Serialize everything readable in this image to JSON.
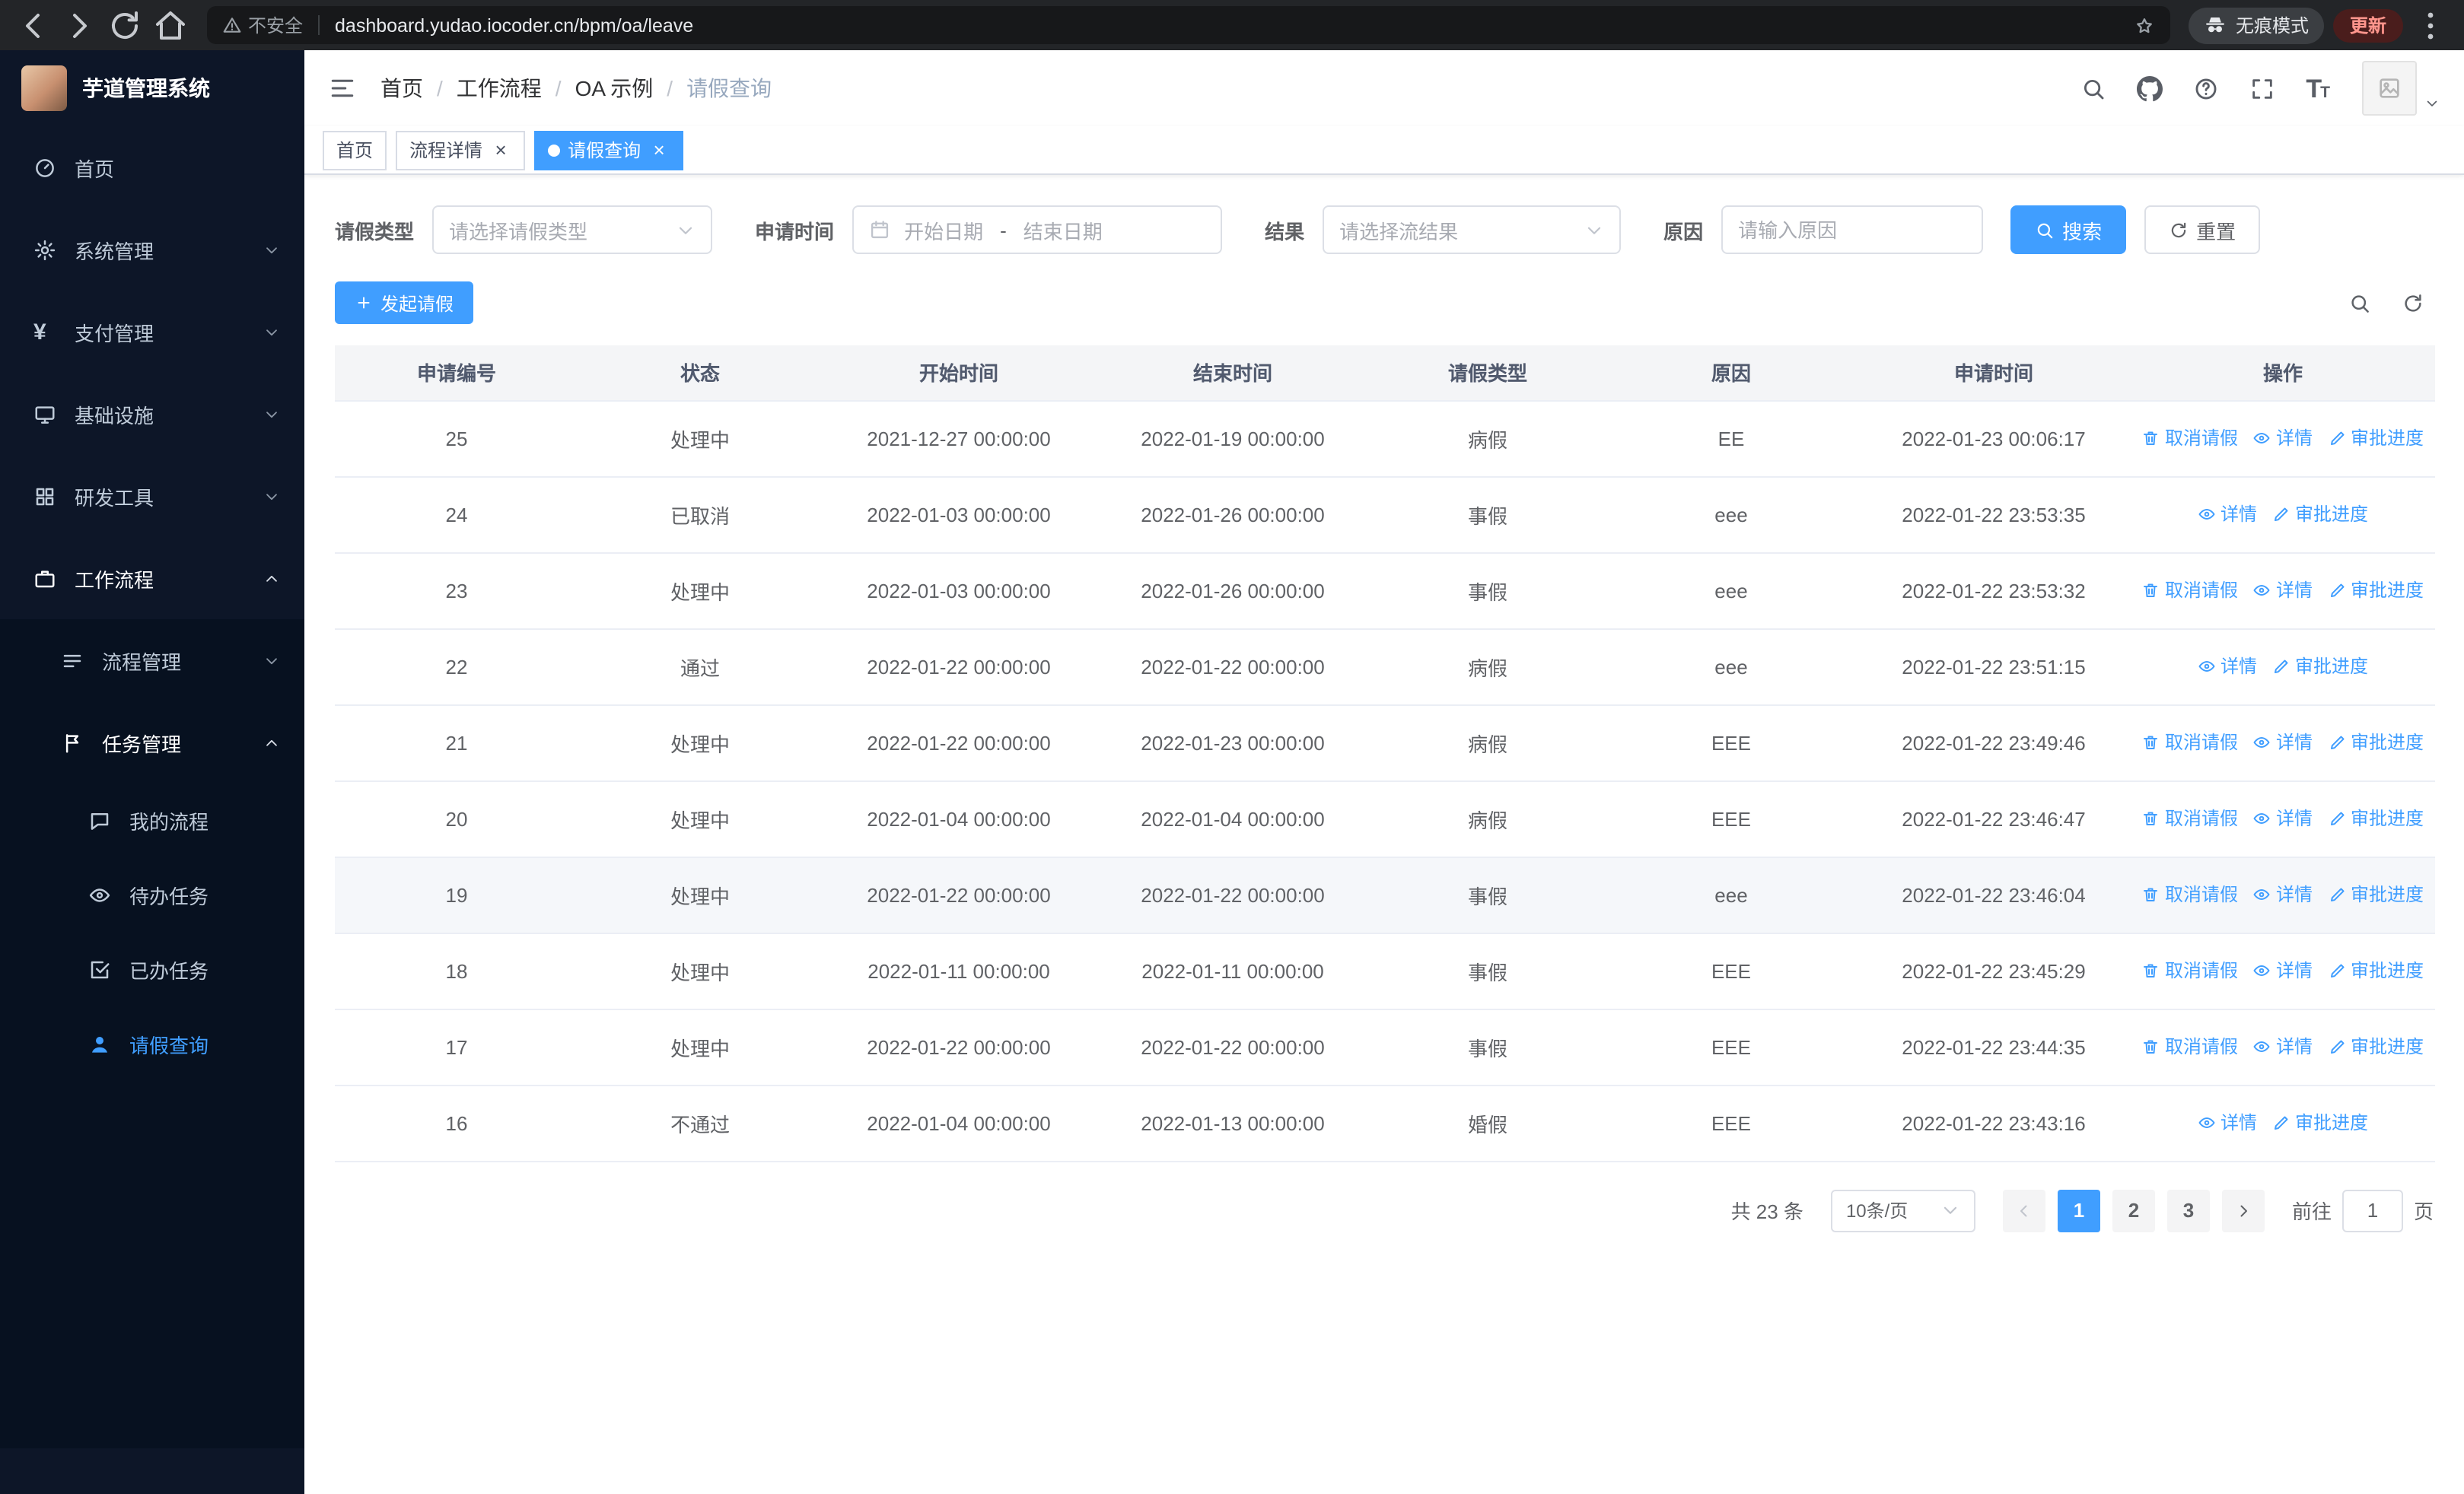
{
  "browser": {
    "url": "dashboard.yudao.iocoder.cn/bpm/oa/leave",
    "security_warning": "不安全",
    "incognito_label": "无痕模式",
    "update_label": "更新"
  },
  "sidebar": {
    "logo_title": "芋道管理系统",
    "menu": [
      {
        "label": "首页",
        "icon": "dashboard-icon",
        "level": 1,
        "sub": false,
        "arrow": null,
        "state": "normal"
      },
      {
        "label": "系统管理",
        "icon": "gear-icon",
        "level": 1,
        "sub": false,
        "arrow": "down",
        "state": "normal"
      },
      {
        "label": "支付管理",
        "icon": "yen-icon",
        "level": 1,
        "sub": false,
        "arrow": "down",
        "state": "normal"
      },
      {
        "label": "基础设施",
        "icon": "infrastructure-icon",
        "level": 1,
        "sub": false,
        "arrow": "down",
        "state": "normal"
      },
      {
        "label": "研发工具",
        "icon": "tools-icon",
        "level": 1,
        "sub": false,
        "arrow": "down",
        "state": "normal"
      },
      {
        "label": "工作流程",
        "icon": "workflow-icon",
        "level": 1,
        "sub": false,
        "arrow": "up",
        "state": "open"
      },
      {
        "label": "流程管理",
        "icon": "process-icon",
        "level": 2,
        "sub": true,
        "arrow": "down",
        "state": "normal"
      },
      {
        "label": "任务管理",
        "icon": "task-icon",
        "level": 2,
        "sub": true,
        "arrow": "up",
        "state": "open"
      },
      {
        "label": "我的流程",
        "icon": "my-process-icon",
        "level": 3,
        "sub": true,
        "arrow": null,
        "state": "normal"
      },
      {
        "label": "待办任务",
        "icon": "eye-icon",
        "level": 3,
        "sub": true,
        "arrow": null,
        "state": "normal"
      },
      {
        "label": "已办任务",
        "icon": "done-task-icon",
        "level": 3,
        "sub": true,
        "arrow": null,
        "state": "normal"
      },
      {
        "label": "请假查询",
        "icon": "user-icon",
        "level": 3,
        "sub": true,
        "arrow": null,
        "state": "active"
      }
    ]
  },
  "header": {
    "breadcrumb": [
      "首页",
      "工作流程",
      "OA 示例",
      "请假查询"
    ]
  },
  "tabs": [
    {
      "label": "首页",
      "closable": false,
      "active": false
    },
    {
      "label": "流程详情",
      "closable": true,
      "active": false
    },
    {
      "label": "请假查询",
      "closable": true,
      "active": true
    }
  ],
  "filters": {
    "type_label": "请假类型",
    "type_placeholder": "请选择请假类型",
    "time_label": "申请时间",
    "date_start_placeholder": "开始日期",
    "date_separator": "-",
    "date_end_placeholder": "结束日期",
    "result_label": "结果",
    "result_placeholder": "请选择流结果",
    "reason_label": "原因",
    "reason_placeholder": "请输入原因",
    "search_label": "搜索",
    "reset_label": "重置"
  },
  "toolbar": {
    "create_label": "发起请假"
  },
  "table": {
    "headers": [
      "申请编号",
      "状态",
      "开始时间",
      "结束时间",
      "请假类型",
      "原因",
      "申请时间",
      "操作"
    ],
    "action_labels": {
      "cancel": "取消请假",
      "detail": "详情",
      "progress": "审批进度"
    },
    "rows": [
      {
        "id": "25",
        "status": "处理中",
        "start": "2021-12-27 00:00:00",
        "end": "2022-01-19 00:00:00",
        "type": "病假",
        "reason": "EE",
        "apply_time": "2022-01-23 00:06:17",
        "actions": [
          "cancel",
          "detail",
          "progress"
        ]
      },
      {
        "id": "24",
        "status": "已取消",
        "start": "2022-01-03 00:00:00",
        "end": "2022-01-26 00:00:00",
        "type": "事假",
        "reason": "eee",
        "apply_time": "2022-01-22 23:53:35",
        "actions": [
          "detail",
          "progress"
        ]
      },
      {
        "id": "23",
        "status": "处理中",
        "start": "2022-01-03 00:00:00",
        "end": "2022-01-26 00:00:00",
        "type": "事假",
        "reason": "eee",
        "apply_time": "2022-01-22 23:53:32",
        "actions": [
          "cancel",
          "detail",
          "progress"
        ]
      },
      {
        "id": "22",
        "status": "通过",
        "start": "2022-01-22 00:00:00",
        "end": "2022-01-22 00:00:00",
        "type": "病假",
        "reason": "eee",
        "apply_time": "2022-01-22 23:51:15",
        "actions": [
          "detail",
          "progress"
        ]
      },
      {
        "id": "21",
        "status": "处理中",
        "start": "2022-01-22 00:00:00",
        "end": "2022-01-23 00:00:00",
        "type": "病假",
        "reason": "EEE",
        "apply_time": "2022-01-22 23:49:46",
        "actions": [
          "cancel",
          "detail",
          "progress"
        ]
      },
      {
        "id": "20",
        "status": "处理中",
        "start": "2022-01-04 00:00:00",
        "end": "2022-01-04 00:00:00",
        "type": "病假",
        "reason": "EEE",
        "apply_time": "2022-01-22 23:46:47",
        "actions": [
          "cancel",
          "detail",
          "progress"
        ]
      },
      {
        "id": "19",
        "status": "处理中",
        "start": "2022-01-22 00:00:00",
        "end": "2022-01-22 00:00:00",
        "type": "事假",
        "reason": "eee",
        "apply_time": "2022-01-22 23:46:04",
        "actions": [
          "cancel",
          "detail",
          "progress"
        ],
        "hover": true
      },
      {
        "id": "18",
        "status": "处理中",
        "start": "2022-01-11 00:00:00",
        "end": "2022-01-11 00:00:00",
        "type": "事假",
        "reason": "EEE",
        "apply_time": "2022-01-22 23:45:29",
        "actions": [
          "cancel",
          "detail",
          "progress"
        ]
      },
      {
        "id": "17",
        "status": "处理中",
        "start": "2022-01-22 00:00:00",
        "end": "2022-01-22 00:00:00",
        "type": "事假",
        "reason": "EEE",
        "apply_time": "2022-01-22 23:44:35",
        "actions": [
          "cancel",
          "detail",
          "progress"
        ]
      },
      {
        "id": "16",
        "status": "不通过",
        "start": "2022-01-04 00:00:00",
        "end": "2022-01-13 00:00:00",
        "type": "婚假",
        "reason": "EEE",
        "apply_time": "2022-01-22 23:43:16",
        "actions": [
          "detail",
          "progress"
        ]
      }
    ]
  },
  "pagination": {
    "total_text": "共 23 条",
    "page_size": "10条/页",
    "pages": [
      "1",
      "2",
      "3"
    ],
    "active_page": "1",
    "goto_label": "前往",
    "goto_value": "1",
    "unit_label": "页"
  },
  "colors": {
    "accent": "#409eff",
    "sidebar_bg": "#0d1628",
    "submenu_bg": "#071120"
  }
}
